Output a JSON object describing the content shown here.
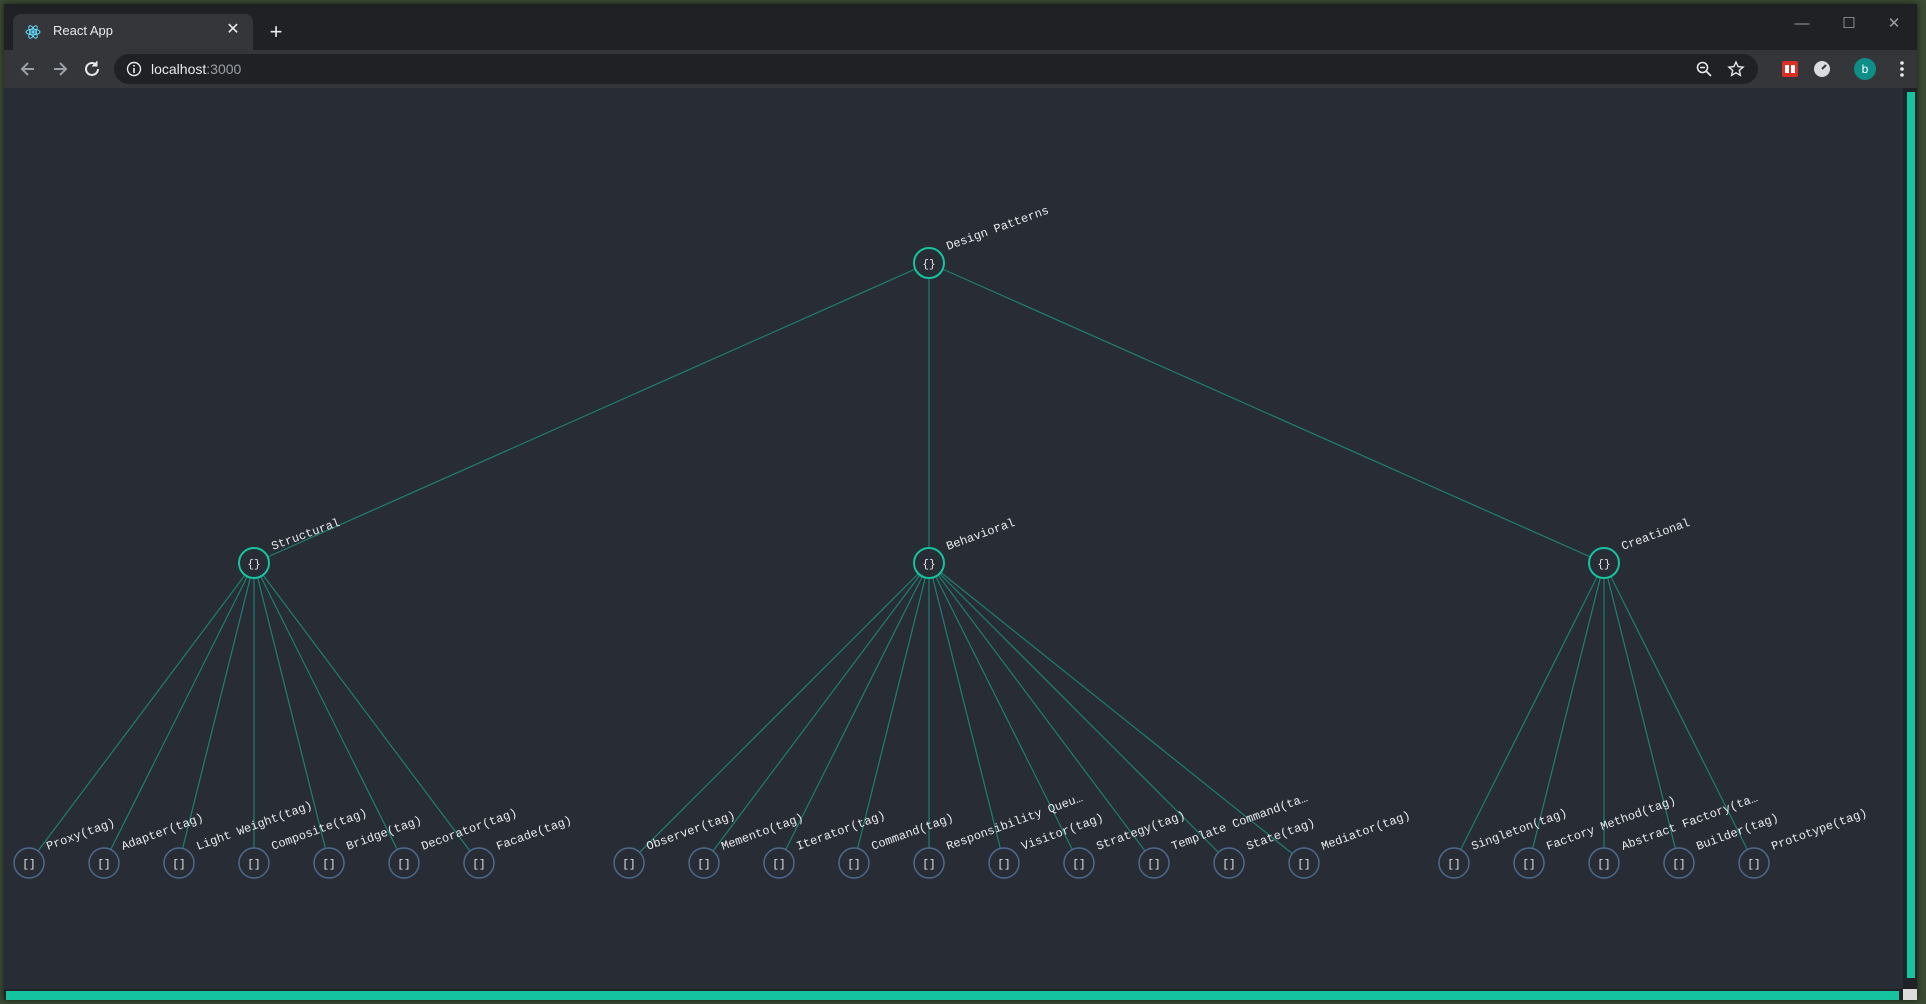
{
  "browser": {
    "tab_title": "React App",
    "url_host": "localhost",
    "url_port": ":3000",
    "profile_initial": "b",
    "icons": {
      "favicon": "react-logo-icon",
      "close_tab": "close-icon",
      "new_tab": "plus-icon",
      "back": "arrow-left-icon",
      "forward": "arrow-right-icon",
      "reload": "reload-icon",
      "site_info": "info-icon",
      "zoom": "zoom-out-icon",
      "bookmark": "star-icon",
      "menu": "kebab-menu-icon"
    }
  },
  "tree": {
    "root": {
      "label": "Design Patterns",
      "glyph": "{}"
    },
    "branches": [
      {
        "label": "Structural",
        "glyph": "{}",
        "children": [
          "Proxy(tag)",
          "Adapter(tag)",
          "Light Weight(tag)",
          "Composite(tag)",
          "Bridge(tag)",
          "Decorator(tag)",
          "Facade(tag)"
        ]
      },
      {
        "label": "Behavioral",
        "glyph": "{}",
        "children": [
          "Observer(tag)",
          "Memento(tag)",
          "Iterator(tag)",
          "Command(tag)",
          "Responsibility Queu…",
          "Visitor(tag)",
          "Strategy(tag)",
          "Template Command(ta…",
          "State(tag)",
          "Mediator(tag)"
        ]
      },
      {
        "label": "Creational",
        "glyph": "{}",
        "children": [
          "Singleton(tag)",
          "Factory Method(tag)",
          "Abstract Factory(ta…",
          "Builder(tag)",
          "Prototype(tag)"
        ]
      }
    ],
    "leaf_glyph": "[]"
  },
  "colors": {
    "background": "#282c34",
    "accent": "#16c3a1",
    "link": "#1e7f72",
    "leaf_stroke": "#4d6a8e",
    "text": "#e8eaed"
  }
}
